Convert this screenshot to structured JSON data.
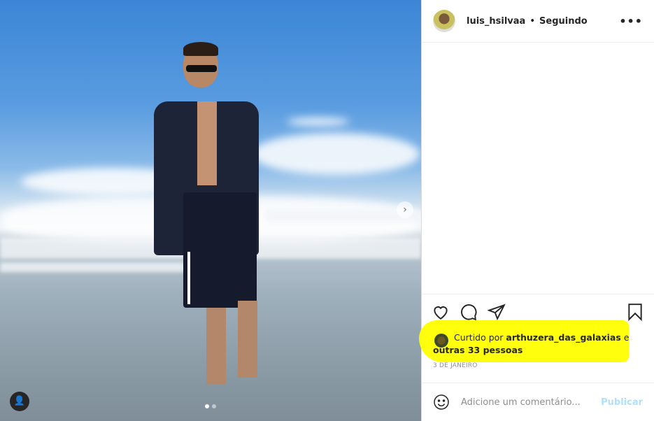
{
  "post": {
    "username": "luis_hsilvaa",
    "separator": "•",
    "follow_status": "Seguindo",
    "more": "•••"
  },
  "likes": {
    "prefix": "Curtido por ",
    "user": "arthuzera_das_galaxias",
    "middle": " e ",
    "others": "outras 33 pessoas"
  },
  "date": "3 DE JANEIRO",
  "comment": {
    "placeholder": "Adicione um comentário...",
    "publish": "Publicar"
  },
  "photo": {
    "next": "›",
    "user_tag": "👤"
  },
  "colors": {
    "highlight": "#ffff00",
    "publish": "#b2dffc"
  }
}
